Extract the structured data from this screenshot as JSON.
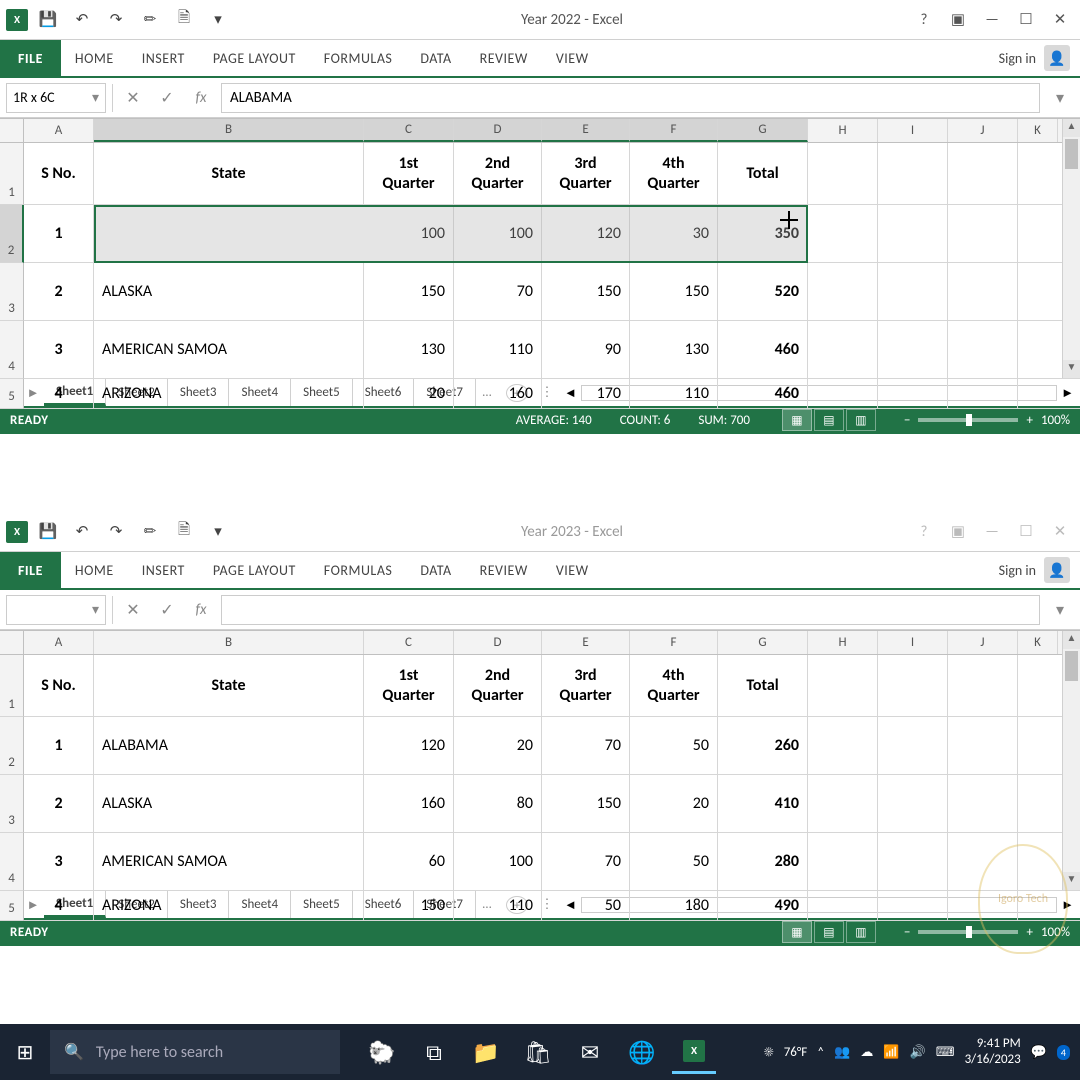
{
  "windows": [
    {
      "title": "Year 2022 - Excel",
      "name_box": "1R x 6C",
      "formula": "ALABAMA",
      "selected_row": 2,
      "show_stats": true,
      "stats": {
        "average": "AVERAGE: 140",
        "count": "COUNT: 6",
        "sum": "SUM: 700"
      }
    },
    {
      "title": "Year 2023 - Excel",
      "name_box": "",
      "formula": "",
      "selected_row": null,
      "show_stats": false,
      "stats": {
        "average": "",
        "count": "",
        "sum": ""
      }
    }
  ],
  "ribbon": {
    "file": "FILE",
    "tabs": [
      "HOME",
      "INSERT",
      "PAGE LAYOUT",
      "FORMULAS",
      "DATA",
      "REVIEW",
      "VIEW"
    ],
    "signin": "Sign in"
  },
  "columns": [
    "A",
    "B",
    "C",
    "D",
    "E",
    "F",
    "G",
    "H",
    "I",
    "J",
    "K"
  ],
  "headers": {
    "sno": "S No.",
    "state": "State",
    "q1": "1st Quarter",
    "q2": "2nd Quarter",
    "q3": "3rd Quarter",
    "q4": "4th Quarter",
    "total": "Total"
  },
  "chart_data": [
    {
      "type": "table",
      "title": "Year 2022",
      "columns": [
        "S No.",
        "State",
        "1st Quarter",
        "2nd Quarter",
        "3rd Quarter",
        "4th Quarter",
        "Total"
      ],
      "rows": [
        [
          1,
          "ALABAMA",
          100,
          100,
          120,
          30,
          350
        ],
        [
          2,
          "ALASKA",
          150,
          70,
          150,
          150,
          520
        ],
        [
          3,
          "AMERICAN SAMOA",
          130,
          110,
          90,
          130,
          460
        ],
        [
          4,
          "ARIZONA",
          20,
          160,
          170,
          110,
          460
        ]
      ]
    },
    {
      "type": "table",
      "title": "Year 2023",
      "columns": [
        "S No.",
        "State",
        "1st Quarter",
        "2nd Quarter",
        "3rd Quarter",
        "4th Quarter",
        "Total"
      ],
      "rows": [
        [
          1,
          "ALABAMA",
          120,
          20,
          70,
          50,
          260
        ],
        [
          2,
          "ALASKA",
          160,
          80,
          150,
          20,
          410
        ],
        [
          3,
          "AMERICAN SAMOA",
          60,
          100,
          70,
          50,
          280
        ],
        [
          4,
          "ARIZONA",
          150,
          110,
          50,
          180,
          490
        ]
      ]
    }
  ],
  "sheets": [
    "Sheet1",
    "Sheet2",
    "Sheet3",
    "Sheet4",
    "Sheet5",
    "Sheet6",
    "Sheet7"
  ],
  "status": {
    "ready": "READY",
    "zoom": "100%"
  },
  "taskbar": {
    "search_placeholder": "Type here to search",
    "weather": "76°F",
    "time": "9:41 PM",
    "date": "3/16/2023",
    "notif": "4"
  },
  "watermark": "Igoro Tech"
}
